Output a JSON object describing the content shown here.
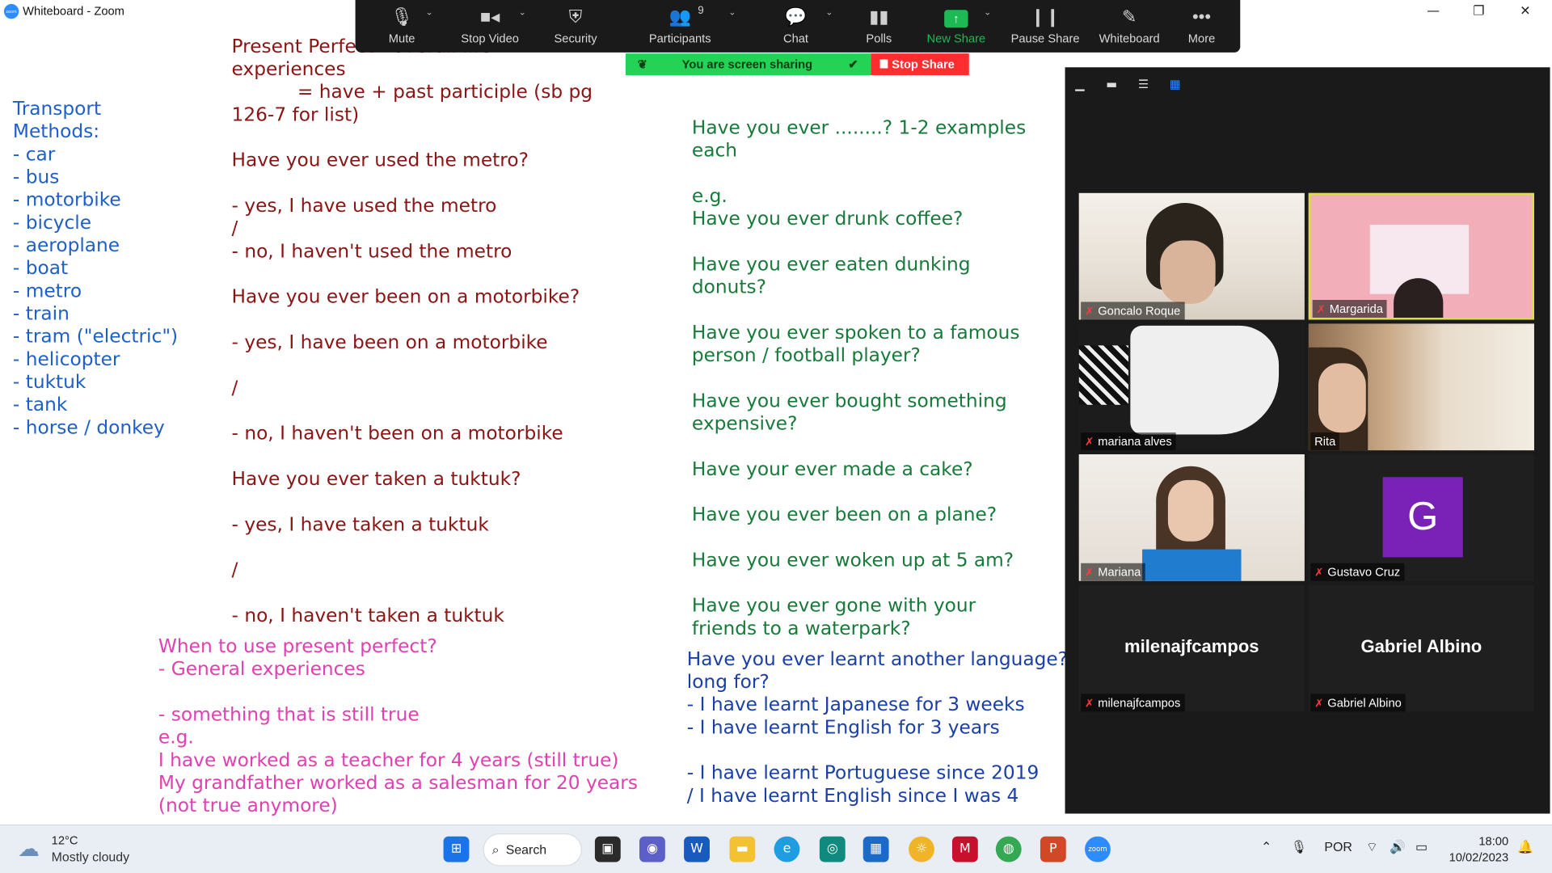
{
  "window": {
    "title": "Whiteboard - Zoom",
    "app_icon": "zoom"
  },
  "whiteboard": {
    "transport_block": "Transport\nMethods:\n- car\n- bus\n- motorbike\n- bicycle\n- aeroplane\n- boat\n- metro\n- train\n- tram (\"electric\")\n- helicopter\n- tuktuk\n- tank\n- horse / donkey",
    "present_perfect_block": "Present Perfect - overall life\nexperiences\n           = have + past participle (sb pg\n126-7 for list)\n\nHave you ever used the metro?\n\n- yes, I have used the metro\n/\n- no, I haven't used the metro\n\nHave you ever been on a motorbike?\n\n- yes, I have been on a motorbike\n\n/\n\n- no, I haven't been on a motorbike\n\nHave you ever taken a tuktuk?\n\n- yes, I have taken a tuktuk\n\n/\n\n- no, I haven't taken a tuktuk",
    "examples_block": "Have you ever ........? 1-2 examples\neach\n\ne.g.\nHave you ever drunk coffee?\n\nHave you ever eaten dunking\ndonuts?\n\nHave you ever spoken to a famous\nperson / football player?\n\nHave you ever bought something\nexpensive?\n\nHave your ever made a cake?\n\nHave you ever been on a plane?\n\nHave you ever woken up at 5 am?\n\nHave you ever gone with your\nfriends to a waterpark?",
    "when_block": "When to use present perfect?\n- General experiences\n\n- something that is still true\ne.g.\nI have worked as a teacher for 4 years (still true)\nMy grandfather worked as a salesman for 20 years\n(not true anymore)",
    "language_block": "Have you ever learnt another language? How\nlong for?\n- I have learnt Japanese for 3 weeks\n- I have learnt English for 3 years\n\n- I have learnt Portuguese since 2019\n/ I have learnt English since I was 4"
  },
  "toolbar": {
    "buttons": [
      {
        "label": "Mute",
        "icon": "microphone-icon"
      },
      {
        "label": "Stop Video",
        "icon": "video-camera-icon"
      },
      {
        "label": "Security",
        "icon": "shield-icon"
      },
      {
        "label": "Participants",
        "icon": "participants-icon",
        "count": "9"
      },
      {
        "label": "Chat",
        "icon": "chat-icon"
      },
      {
        "label": "Polls",
        "icon": "polls-icon"
      },
      {
        "label": "New Share",
        "icon": "share-arrow-icon"
      },
      {
        "label": "Pause Share",
        "icon": "pause-icon"
      },
      {
        "label": "Whiteboard",
        "icon": "pen-icon"
      },
      {
        "label": "More",
        "icon": "more-dots-icon"
      }
    ],
    "sharing_status": "You are screen sharing",
    "stop_share": "Stop Share"
  },
  "gallery": {
    "participants": [
      {
        "name": "Goncalo Roque"
      },
      {
        "name": "Margarida"
      },
      {
        "name": "mariana alves"
      },
      {
        "name": "Rita"
      },
      {
        "name": "Mariana"
      },
      {
        "name": "Gustavo Cruz",
        "avatar_letter": "G"
      },
      {
        "name": "milenajfcampos",
        "display": "milenajfcampos"
      },
      {
        "name": "Gabriel Albino",
        "display": "Gabriel Albino"
      }
    ]
  },
  "taskbar": {
    "weather_temp": "12°C",
    "weather_desc": "Mostly cloudy",
    "search_label": "Search",
    "language": "POR",
    "time": "18:00",
    "date": "10/02/2023"
  },
  "colors": {
    "toolbar_bg": "#1a1a1a",
    "share_green": "#24d256",
    "stop_red": "#ff2d2d",
    "active_speaker": "#d9e23c",
    "avatar_purple": "#7a22b8"
  }
}
